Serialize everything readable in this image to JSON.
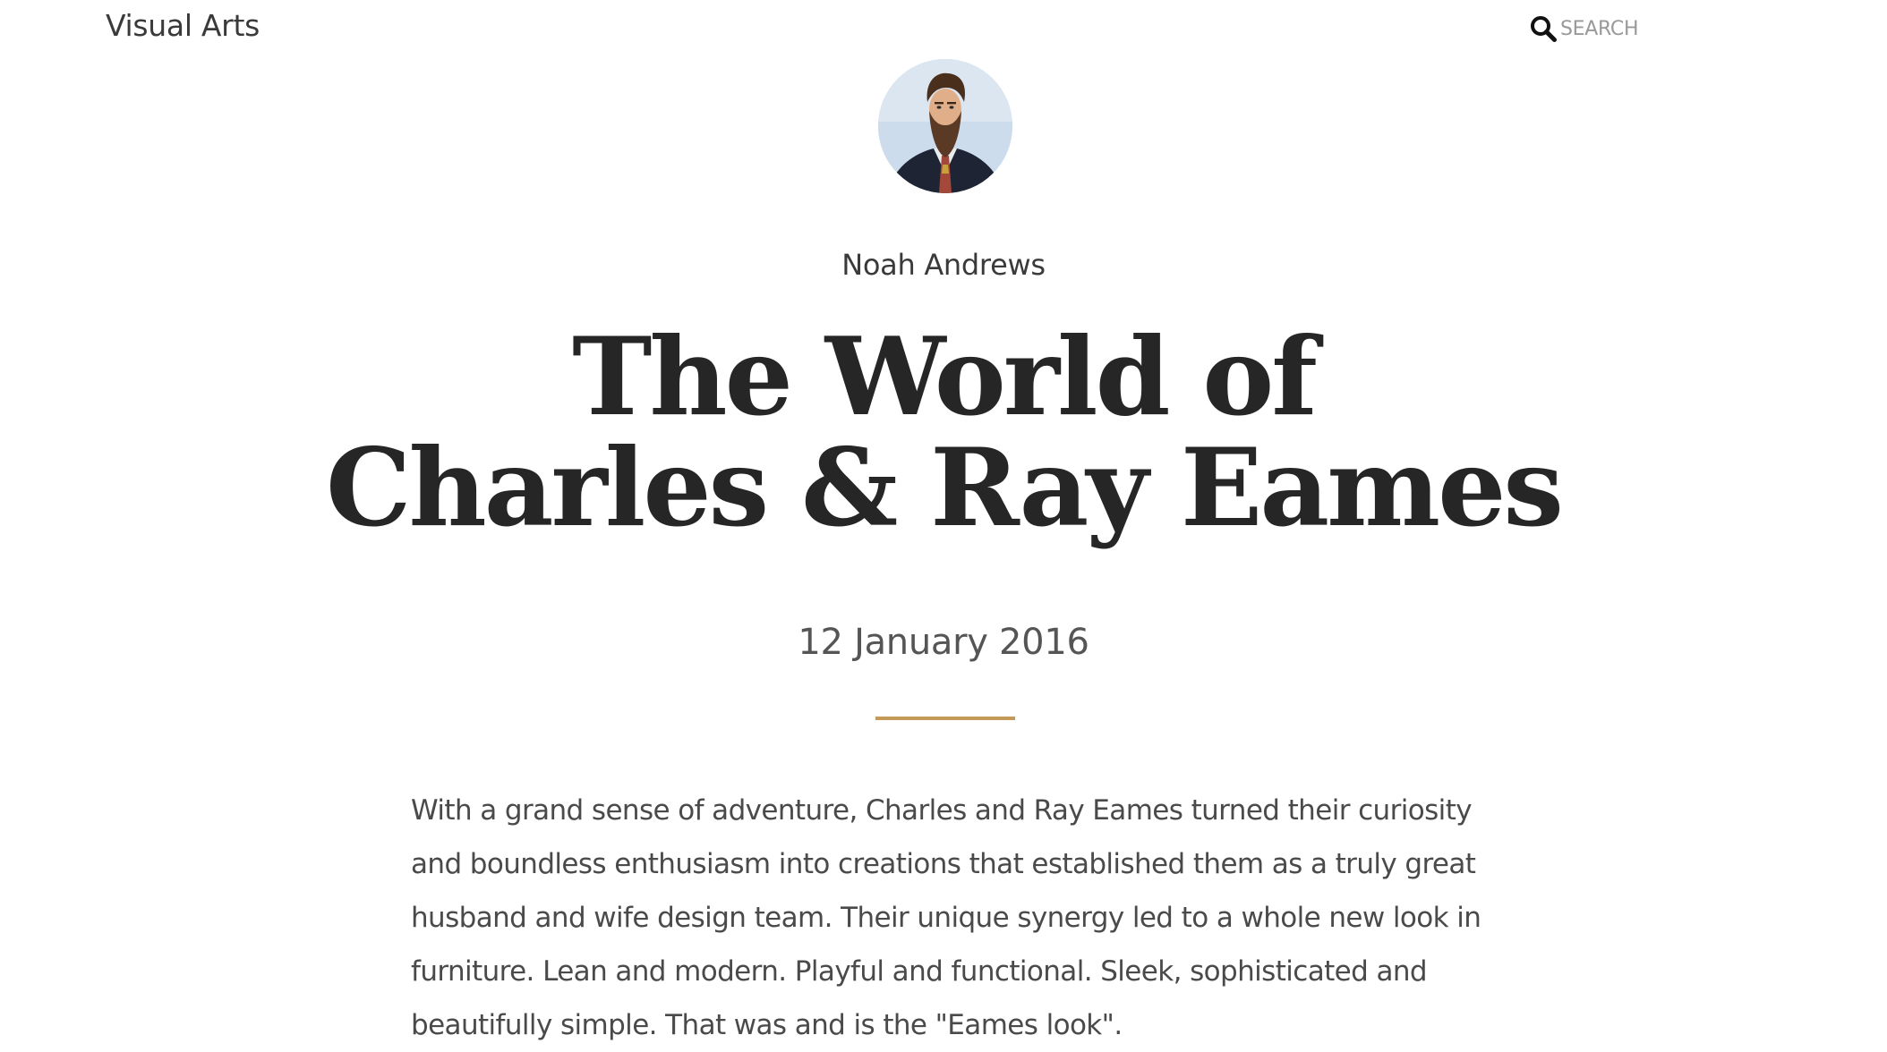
{
  "header": {
    "site_title": "Visual Arts",
    "search": {
      "placeholder": "SEARCH",
      "value": "",
      "icon": "magnifier-icon"
    }
  },
  "post": {
    "author": {
      "name": "Noah Andrews",
      "avatar": "bearded-man-portrait"
    },
    "title_lines": [
      "The World of",
      "Charles & Ray Eames"
    ],
    "date": "12 January 2016",
    "divider_color": "#c49a58",
    "body": "With a grand sense of adventure, Charles and Ray Eames turned their curiosity and boundless enthusiasm into creations that established them as a truly great husband and wife design team. Their unique synergy led to a whole new look in furniture. Lean and modern. Playful and functional. Sleek, sophisticated and beautifully simple. That was and is the \"Eames look\"."
  }
}
